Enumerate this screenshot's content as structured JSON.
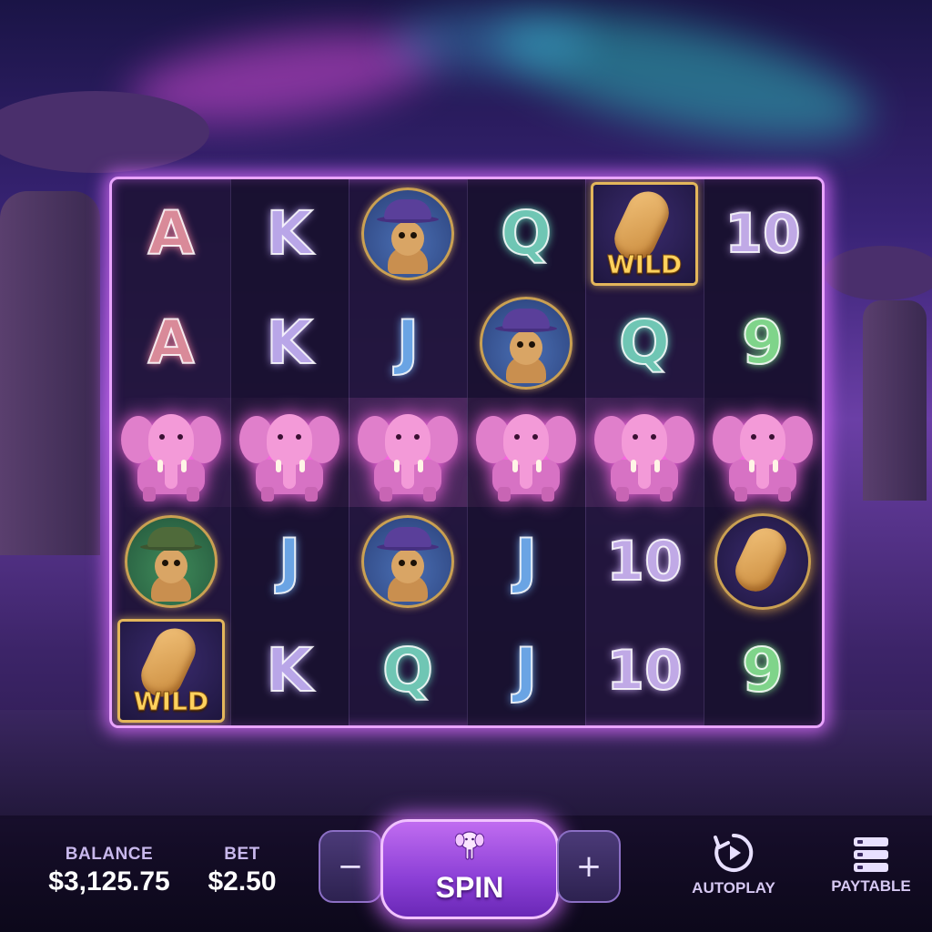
{
  "colors": {
    "frame_glow": "#e9a4ff",
    "spin_button": "#9b4be0",
    "wild_text": "#ffd25e",
    "stat_label": "#c8b8ec"
  },
  "reels": [
    [
      "A",
      "A",
      "elephant",
      "meerkat",
      "wild"
    ],
    [
      "K",
      "K",
      "elephant",
      "J",
      "K"
    ],
    [
      "meerkat",
      "J",
      "elephant",
      "meerkat",
      "Q"
    ],
    [
      "Q",
      "meerkat-blue",
      "elephant",
      "J",
      "J"
    ],
    [
      "wild",
      "Q",
      "elephant",
      "10",
      "10"
    ],
    [
      "10",
      "9",
      "elephant",
      "peanut",
      "9"
    ]
  ],
  "wild_label": "WILD",
  "winning_row": 3,
  "hud": {
    "balance_label": "BALANCE",
    "balance_value": "$3,125.75",
    "bet_label": "BET",
    "bet_value": "$2.50",
    "minus_label": "−",
    "plus_label": "+",
    "spin_label": "SPIN",
    "spin_icon": "elephant-icon",
    "autoplay_label": "AUTOPLAY",
    "autoplay_icon": "autoplay-icon",
    "paytable_label": "PAYTABLE",
    "paytable_icon": "paytable-icon"
  }
}
